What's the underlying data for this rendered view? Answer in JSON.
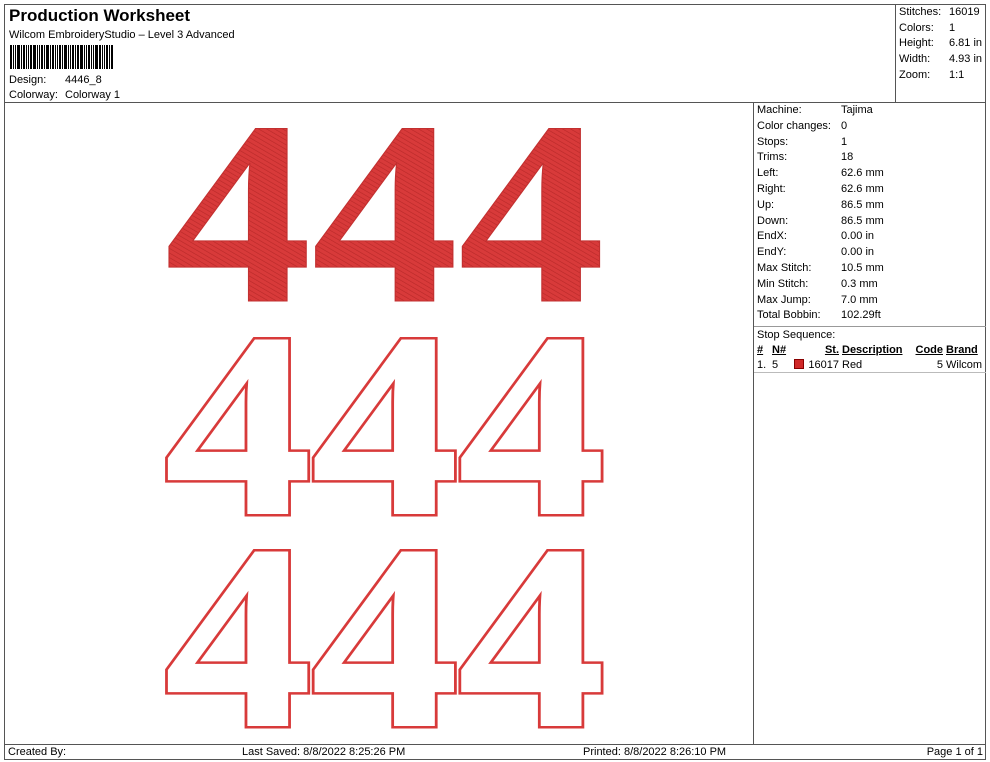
{
  "header": {
    "title": "Production Worksheet",
    "subtitle": "Wilcom EmbroideryStudio – Level 3 Advanced",
    "design_label": "Design:",
    "design_value": "4446_8",
    "colorway_label": "Colorway:",
    "colorway_value": "Colorway 1"
  },
  "stats": [
    {
      "label": "Stitches:",
      "value": "16019"
    },
    {
      "label": "Colors:",
      "value": "1"
    },
    {
      "label": "Height:",
      "value": "6.81 in"
    },
    {
      "label": "Width:",
      "value": "4.93 in"
    },
    {
      "label": "Zoom:",
      "value": "1:1"
    }
  ],
  "info": [
    {
      "label": "Machine:",
      "value": "Tajima"
    },
    {
      "label": "Color changes:",
      "value": "0"
    },
    {
      "label": "Stops:",
      "value": "1"
    },
    {
      "label": "Trims:",
      "value": "18"
    },
    {
      "label": "Left:",
      "value": "62.6 mm"
    },
    {
      "label": "Right:",
      "value": "62.6 mm"
    },
    {
      "label": "Up:",
      "value": "86.5 mm"
    },
    {
      "label": "Down:",
      "value": "86.5 mm"
    },
    {
      "label": "EndX:",
      "value": "0.00 in"
    },
    {
      "label": "EndY:",
      "value": "0.00 in"
    },
    {
      "label": "Max Stitch:",
      "value": "10.5 mm"
    },
    {
      "label": "Min Stitch:",
      "value": "0.3 mm"
    },
    {
      "label": "Max Jump:",
      "value": "7.0 mm"
    },
    {
      "label": "Total Bobbin:",
      "value": "102.29ft"
    }
  ],
  "stop_sequence": {
    "title": "Stop Sequence:",
    "headers": [
      "#",
      "N#",
      "St.",
      "Description",
      "Code",
      "Brand"
    ],
    "rows": [
      {
        "num": "1.",
        "n": "5",
        "st": "16017",
        "description": "Red",
        "code": "5",
        "brand": "Wilcom",
        "color": "#d02828"
      }
    ]
  },
  "design": {
    "text_row1": "444",
    "text_row2": "444",
    "text_row3": "444",
    "thread_color": "#d83a3a"
  },
  "footer": {
    "created_by": "Created By:",
    "last_saved": "Last Saved: 8/8/2022 8:25:26 PM",
    "printed": "Printed: 8/8/2022 8:26:10 PM",
    "page": "Page 1 of 1"
  }
}
